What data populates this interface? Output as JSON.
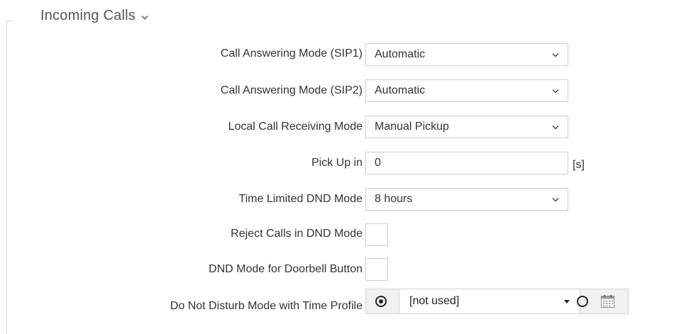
{
  "section": {
    "title": "Incoming Calls",
    "chevron_icon": "chevron-down-icon"
  },
  "fields": {
    "call_answering_sip1": {
      "label": "Call Answering Mode (SIP1)",
      "value": "Automatic"
    },
    "call_answering_sip2": {
      "label": "Call Answering Mode (SIP2)",
      "value": "Automatic"
    },
    "local_call_receiving": {
      "label": "Local Call Receiving Mode",
      "value": "Manual Pickup"
    },
    "pick_up_in": {
      "label": "Pick Up in",
      "value": "0",
      "unit": "[s]"
    },
    "time_limited_dnd": {
      "label": "Time Limited DND Mode",
      "value": "8 hours"
    },
    "reject_calls_dnd": {
      "label": "Reject Calls in DND Mode",
      "checked": false
    },
    "dnd_doorbell": {
      "label": "DND Mode for Doorbell Button",
      "checked": false
    },
    "dnd_time_profile": {
      "label": "Do Not Disturb Mode with Time Profile",
      "selected_option": "time-profile",
      "profile_value": "[not used]",
      "calendar_icon": "calendar-icon"
    }
  },
  "colors": {
    "border": "#cfcfcf",
    "text": "#333333",
    "group_bg": "#f1f1f1"
  }
}
